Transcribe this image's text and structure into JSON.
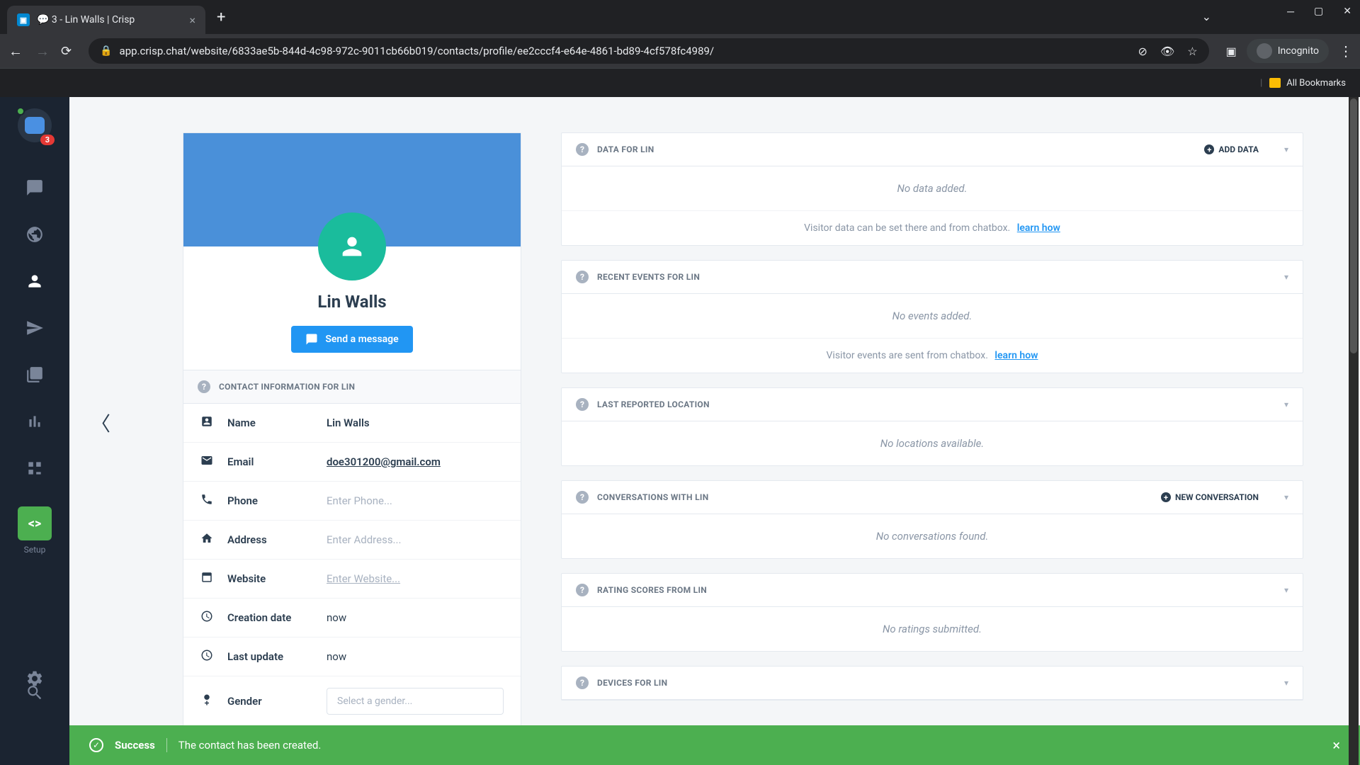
{
  "browser": {
    "tab_title": "💬 3 - Lin Walls | Crisp",
    "url": "app.crisp.chat/website/6833ae5b-844d-4c98-972c-9011cb66b019/contacts/profile/ee2cccf4-e64e-4861-bd89-4cf578fc4989/",
    "incognito": "Incognito",
    "all_bookmarks": "All Bookmarks"
  },
  "sidebar": {
    "badge": "3",
    "setup": "Setup"
  },
  "profile": {
    "name": "Lin Walls",
    "send_button": "Send a message",
    "contact_header": "CONTACT INFORMATION FOR LIN",
    "rows": {
      "name_label": "Name",
      "name_value": "Lin Walls",
      "email_label": "Email",
      "email_value": "doe301200@gmail.com",
      "phone_label": "Phone",
      "phone_placeholder": "Enter Phone...",
      "address_label": "Address",
      "address_placeholder": "Enter Address...",
      "website_label": "Website",
      "website_placeholder": "Enter Website...",
      "creation_label": "Creation date",
      "creation_value": "now",
      "update_label": "Last update",
      "update_value": "now",
      "gender_label": "Gender",
      "gender_placeholder": "Select a gender..."
    }
  },
  "panels": {
    "data": {
      "title": "DATA FOR LIN",
      "action": "ADD DATA",
      "empty": "No data added.",
      "footer": "Visitor data can be set there and from chatbox.",
      "learn": "learn how"
    },
    "events": {
      "title": "RECENT EVENTS FOR LIN",
      "empty": "No events added.",
      "footer": "Visitor events are sent from chatbox.",
      "learn": "learn how"
    },
    "location": {
      "title": "LAST REPORTED LOCATION",
      "empty": "No locations available."
    },
    "conversations": {
      "title": "CONVERSATIONS WITH LIN",
      "action": "NEW CONVERSATION",
      "empty": "No conversations found."
    },
    "ratings": {
      "title": "RATING SCORES FROM LIN",
      "empty": "No ratings submitted."
    },
    "devices": {
      "title": "DEVICES FOR LIN"
    }
  },
  "toast": {
    "title": "Success",
    "message": "The contact has been created."
  }
}
